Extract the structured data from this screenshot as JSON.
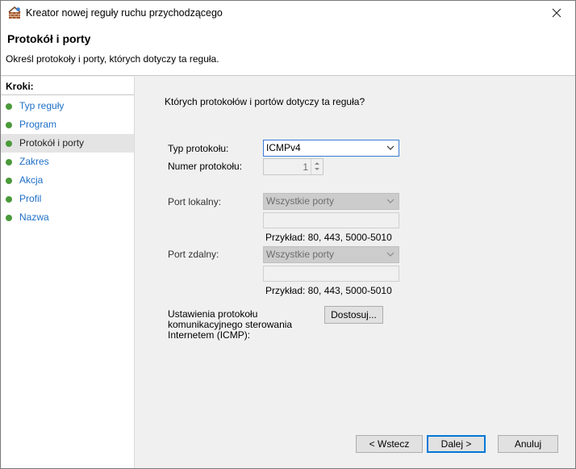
{
  "window": {
    "title": "Kreator nowej reguły ruchu przychodzącego",
    "icons": {
      "app": "firewall-wall-icon",
      "close": "close-icon"
    }
  },
  "header": {
    "title": "Protokół i porty",
    "description": "Określ protokoły i porty, których dotyczy ta reguła."
  },
  "steps": {
    "label": "Kroki:",
    "items": [
      {
        "label": "Typ reguły",
        "active": false
      },
      {
        "label": "Program",
        "active": false
      },
      {
        "label": "Protokół i porty",
        "active": true
      },
      {
        "label": "Zakres",
        "active": false
      },
      {
        "label": "Akcja",
        "active": false
      },
      {
        "label": "Profil",
        "active": false
      },
      {
        "label": "Nazwa",
        "active": false
      }
    ],
    "bullet_color": "#4a9a3a",
    "link_color": "#1e6fc7"
  },
  "main": {
    "question": "Których protokołów i portów dotyczy ta reguła?",
    "protocol_type": {
      "label": "Typ protokołu:",
      "value": "ICMPv4"
    },
    "protocol_number": {
      "label": "Numer protokołu:",
      "value": "1"
    },
    "local_port": {
      "label": "Port lokalny:",
      "value": "Wszystkie porty",
      "input": "",
      "example": "Przykład: 80, 443, 5000-5010"
    },
    "remote_port": {
      "label": "Port zdalny:",
      "value": "Wszystkie porty",
      "input": "",
      "example": "Przykład: 80, 443, 5000-5010"
    },
    "icmp": {
      "label": "Ustawienia protokołu komunikacyjnego sterowania Internetem (ICMP):",
      "button": "Dostosuj..."
    }
  },
  "footer": {
    "back": "< Wstecz",
    "next": "Dalej >",
    "cancel": "Anuluj"
  }
}
